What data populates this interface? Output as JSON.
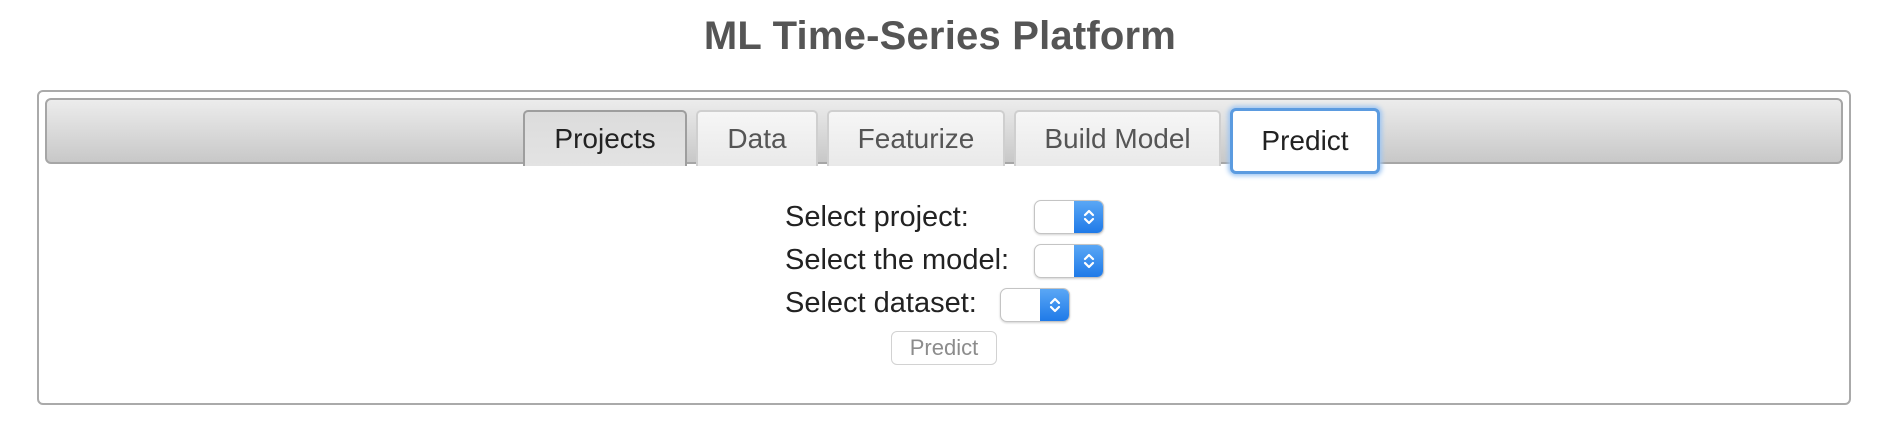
{
  "app": {
    "title": "ML Time-Series Platform"
  },
  "tabs": [
    {
      "label": "Projects"
    },
    {
      "label": "Data"
    },
    {
      "label": "Featurize"
    },
    {
      "label": "Build Model"
    },
    {
      "label": "Predict",
      "active": true
    }
  ],
  "form": {
    "project_label": "Select project:",
    "model_label": "Select the model:",
    "dataset_label": "Select dataset:",
    "project_value": "",
    "model_value": "",
    "dataset_value": "",
    "predict_button_label": "Predict"
  },
  "icons": {
    "select_stepper": "chevron-updown-icon"
  },
  "colors": {
    "title": "#555555",
    "active_tab_border": "#5b9be0",
    "stepper_blue": "#1f7ae8"
  }
}
